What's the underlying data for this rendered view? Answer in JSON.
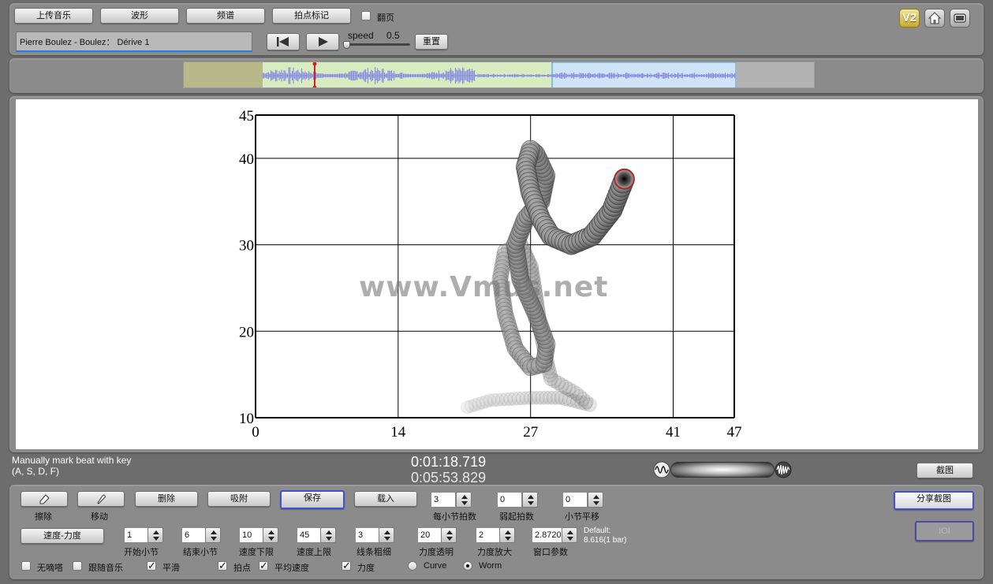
{
  "toolbar": {
    "upload_label": "上传音乐",
    "waveform_label": "波形",
    "spectrum_label": "频谱",
    "beat_mark_label": "拍点标记",
    "page_turn_label": "翻页"
  },
  "track": {
    "title": "Pierre Boulez - Boulez： Dérive 1",
    "speed_label": "speed",
    "speed_value": "0.5",
    "reset_label": "重置"
  },
  "top_right": {
    "v2_label": "V2"
  },
  "chart_data": {
    "type": "line",
    "title": "",
    "xlabel": "",
    "ylabel": "",
    "x_ticks": [
      "0",
      "14",
      "27",
      "41",
      "47"
    ],
    "y_ticks": [
      "45",
      "40",
      "30",
      "20",
      "10"
    ],
    "xlim": [
      0,
      47
    ],
    "ylim": [
      10,
      45
    ],
    "grid": true,
    "render_style": "worm",
    "series": [
      {
        "points": [
          [
            20.8,
            11.2
          ],
          [
            23,
            12
          ],
          [
            27,
            12.3
          ],
          [
            30,
            12.3
          ],
          [
            32.8,
            11.5
          ],
          [
            31.5,
            12.8
          ],
          [
            29,
            14.5
          ],
          [
            28.5,
            17
          ],
          [
            28,
            20
          ],
          [
            27.5,
            24
          ],
          [
            27,
            27.5
          ],
          [
            26,
            30
          ],
          [
            24.5,
            29.2
          ],
          [
            24,
            26
          ],
          [
            24.5,
            22
          ],
          [
            25.5,
            18
          ],
          [
            27,
            15.8
          ],
          [
            28.3,
            16.2
          ],
          [
            28.6,
            18.5
          ],
          [
            27.5,
            22
          ],
          [
            26,
            26
          ],
          [
            25.5,
            30
          ],
          [
            26.5,
            33
          ],
          [
            28,
            35
          ],
          [
            28.5,
            38
          ],
          [
            27.5,
            40.5
          ],
          [
            27,
            41
          ],
          [
            26.5,
            39
          ],
          [
            27,
            36
          ],
          [
            28,
            33
          ],
          [
            29,
            31
          ],
          [
            31,
            30
          ],
          [
            33,
            31
          ],
          [
            35,
            34
          ],
          [
            36.2,
            37.6
          ]
        ]
      }
    ]
  },
  "watermark": "www.Vmus.net",
  "status": {
    "hint_line1": "Manually mark beat with key",
    "hint_line2": "(A, S, D, F)",
    "current_time": "0:01:18.719",
    "total_time": "0:05:53.829",
    "screenshot_label": "截图"
  },
  "controls": {
    "erase_label": "擦除",
    "move_label": "移动",
    "delete_label": "删除",
    "snap_label": "吸附",
    "save_label": "保存",
    "load_label": "载入",
    "share_label": "分享截图",
    "ioi_label": "IOI",
    "speed_dynamics_label": "速度-力度",
    "beats_per_bar": {
      "label": "每小节拍数",
      "value": "3"
    },
    "pickup_beats": {
      "label": "弱起拍数",
      "value": "0"
    },
    "bar_shift": {
      "label": "小节平移",
      "value": "0"
    },
    "start_bar": {
      "label": "开始小节",
      "value": "1"
    },
    "end_bar": {
      "label": "结束小节",
      "value": "6"
    },
    "tempo_min": {
      "label": "速度下限",
      "value": "10"
    },
    "tempo_max": {
      "label": "速度上限",
      "value": "45"
    },
    "line_width": {
      "label": "线条粗细",
      "value": "3"
    },
    "dyn_opacity": {
      "label": "力度透明",
      "value": "20"
    },
    "dyn_scale": {
      "label": "力度放大",
      "value": "2"
    },
    "window_param": {
      "label": "窗口参数",
      "value": "2.8720"
    },
    "default_line1": "Default:",
    "default_line2": "8.616(1 bar)",
    "metronome_label": "无嘀嗒",
    "follow_music_label": "跟随音乐",
    "smooth_label": "平滑",
    "beat_point_label": "拍点",
    "avg_speed_label": "平均速度",
    "dynamics_label": "力度",
    "curve_label": "Curve",
    "worm_label": "Worm"
  },
  "colors": {
    "accent": "#3f52d6",
    "waveform": "#8a8fe0",
    "playhead": "#d22020",
    "seg_past": "#b9b88a",
    "seg_played": "#d9ecc0",
    "seg_selected": "#cfe5f7"
  }
}
